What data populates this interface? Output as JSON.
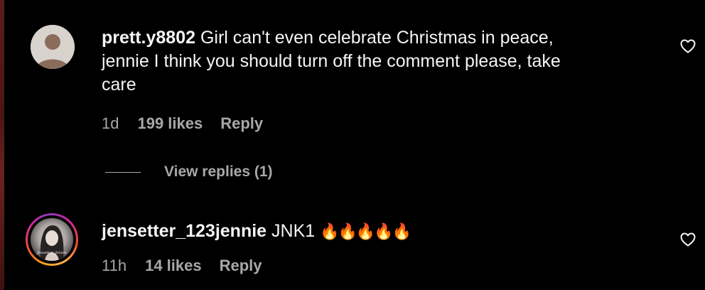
{
  "comments": [
    {
      "username": "prett.y8802",
      "text_line1": "Girl can't even celebrate Christmas in peace,",
      "text_line2": "jennie I think you should turn off the comment please, take",
      "text_line3": "care",
      "time": "1d",
      "likes": "199 likes",
      "reply": "Reply",
      "avatar_icon": "default-user-avatar-icon",
      "like_icon": "heart-outline-icon"
    },
    {
      "username": "jensetter_123jennie",
      "text": "JNK1",
      "emoji": "🔥🔥🔥🔥🔥",
      "time": "11h",
      "likes": "14 likes",
      "reply": "Reply",
      "avatar_caption": "Jensetter_Jennie",
      "like_icon": "heart-outline-icon"
    }
  ],
  "view_replies": "View replies (1)",
  "colors": {
    "background": "#000000",
    "primary_text": "#f5f5f5",
    "secondary_text": "#a8a8a8",
    "default_avatar_bg": "#d9d3ce",
    "default_avatar_fg": "#8b6b5a"
  }
}
